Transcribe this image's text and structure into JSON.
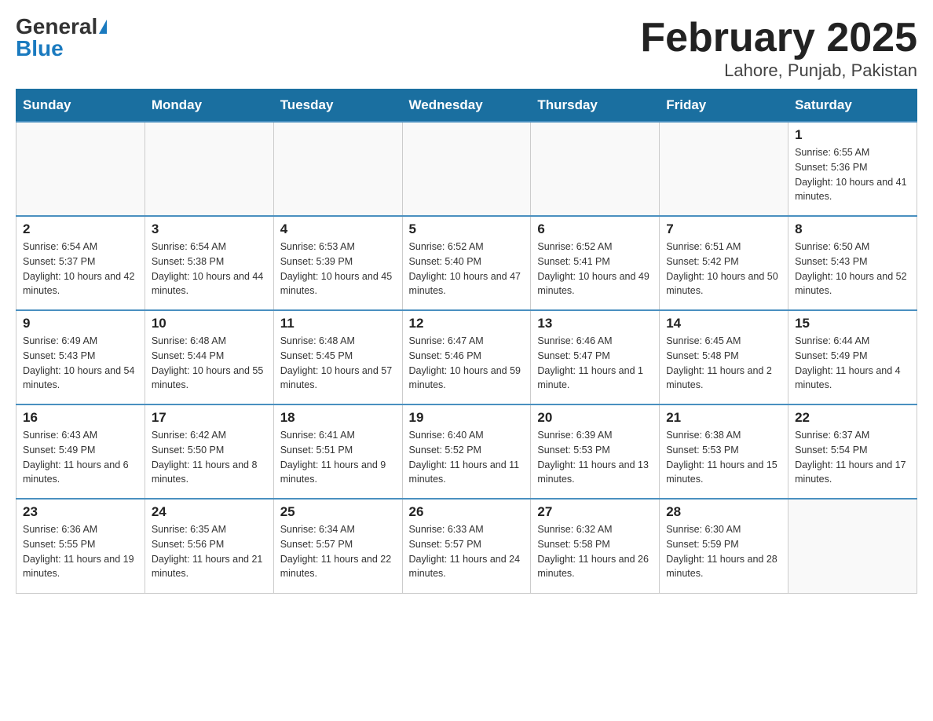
{
  "header": {
    "logo_general": "General",
    "logo_blue": "Blue",
    "month_title": "February 2025",
    "location": "Lahore, Punjab, Pakistan"
  },
  "days_of_week": [
    "Sunday",
    "Monday",
    "Tuesday",
    "Wednesday",
    "Thursday",
    "Friday",
    "Saturday"
  ],
  "weeks": [
    [
      {
        "day": "",
        "sunrise": "",
        "sunset": "",
        "daylight": ""
      },
      {
        "day": "",
        "sunrise": "",
        "sunset": "",
        "daylight": ""
      },
      {
        "day": "",
        "sunrise": "",
        "sunset": "",
        "daylight": ""
      },
      {
        "day": "",
        "sunrise": "",
        "sunset": "",
        "daylight": ""
      },
      {
        "day": "",
        "sunrise": "",
        "sunset": "",
        "daylight": ""
      },
      {
        "day": "",
        "sunrise": "",
        "sunset": "",
        "daylight": ""
      },
      {
        "day": "1",
        "sunrise": "Sunrise: 6:55 AM",
        "sunset": "Sunset: 5:36 PM",
        "daylight": "Daylight: 10 hours and 41 minutes."
      }
    ],
    [
      {
        "day": "2",
        "sunrise": "Sunrise: 6:54 AM",
        "sunset": "Sunset: 5:37 PM",
        "daylight": "Daylight: 10 hours and 42 minutes."
      },
      {
        "day": "3",
        "sunrise": "Sunrise: 6:54 AM",
        "sunset": "Sunset: 5:38 PM",
        "daylight": "Daylight: 10 hours and 44 minutes."
      },
      {
        "day": "4",
        "sunrise": "Sunrise: 6:53 AM",
        "sunset": "Sunset: 5:39 PM",
        "daylight": "Daylight: 10 hours and 45 minutes."
      },
      {
        "day": "5",
        "sunrise": "Sunrise: 6:52 AM",
        "sunset": "Sunset: 5:40 PM",
        "daylight": "Daylight: 10 hours and 47 minutes."
      },
      {
        "day": "6",
        "sunrise": "Sunrise: 6:52 AM",
        "sunset": "Sunset: 5:41 PM",
        "daylight": "Daylight: 10 hours and 49 minutes."
      },
      {
        "day": "7",
        "sunrise": "Sunrise: 6:51 AM",
        "sunset": "Sunset: 5:42 PM",
        "daylight": "Daylight: 10 hours and 50 minutes."
      },
      {
        "day": "8",
        "sunrise": "Sunrise: 6:50 AM",
        "sunset": "Sunset: 5:43 PM",
        "daylight": "Daylight: 10 hours and 52 minutes."
      }
    ],
    [
      {
        "day": "9",
        "sunrise": "Sunrise: 6:49 AM",
        "sunset": "Sunset: 5:43 PM",
        "daylight": "Daylight: 10 hours and 54 minutes."
      },
      {
        "day": "10",
        "sunrise": "Sunrise: 6:48 AM",
        "sunset": "Sunset: 5:44 PM",
        "daylight": "Daylight: 10 hours and 55 minutes."
      },
      {
        "day": "11",
        "sunrise": "Sunrise: 6:48 AM",
        "sunset": "Sunset: 5:45 PM",
        "daylight": "Daylight: 10 hours and 57 minutes."
      },
      {
        "day": "12",
        "sunrise": "Sunrise: 6:47 AM",
        "sunset": "Sunset: 5:46 PM",
        "daylight": "Daylight: 10 hours and 59 minutes."
      },
      {
        "day": "13",
        "sunrise": "Sunrise: 6:46 AM",
        "sunset": "Sunset: 5:47 PM",
        "daylight": "Daylight: 11 hours and 1 minute."
      },
      {
        "day": "14",
        "sunrise": "Sunrise: 6:45 AM",
        "sunset": "Sunset: 5:48 PM",
        "daylight": "Daylight: 11 hours and 2 minutes."
      },
      {
        "day": "15",
        "sunrise": "Sunrise: 6:44 AM",
        "sunset": "Sunset: 5:49 PM",
        "daylight": "Daylight: 11 hours and 4 minutes."
      }
    ],
    [
      {
        "day": "16",
        "sunrise": "Sunrise: 6:43 AM",
        "sunset": "Sunset: 5:49 PM",
        "daylight": "Daylight: 11 hours and 6 minutes."
      },
      {
        "day": "17",
        "sunrise": "Sunrise: 6:42 AM",
        "sunset": "Sunset: 5:50 PM",
        "daylight": "Daylight: 11 hours and 8 minutes."
      },
      {
        "day": "18",
        "sunrise": "Sunrise: 6:41 AM",
        "sunset": "Sunset: 5:51 PM",
        "daylight": "Daylight: 11 hours and 9 minutes."
      },
      {
        "day": "19",
        "sunrise": "Sunrise: 6:40 AM",
        "sunset": "Sunset: 5:52 PM",
        "daylight": "Daylight: 11 hours and 11 minutes."
      },
      {
        "day": "20",
        "sunrise": "Sunrise: 6:39 AM",
        "sunset": "Sunset: 5:53 PM",
        "daylight": "Daylight: 11 hours and 13 minutes."
      },
      {
        "day": "21",
        "sunrise": "Sunrise: 6:38 AM",
        "sunset": "Sunset: 5:53 PM",
        "daylight": "Daylight: 11 hours and 15 minutes."
      },
      {
        "day": "22",
        "sunrise": "Sunrise: 6:37 AM",
        "sunset": "Sunset: 5:54 PM",
        "daylight": "Daylight: 11 hours and 17 minutes."
      }
    ],
    [
      {
        "day": "23",
        "sunrise": "Sunrise: 6:36 AM",
        "sunset": "Sunset: 5:55 PM",
        "daylight": "Daylight: 11 hours and 19 minutes."
      },
      {
        "day": "24",
        "sunrise": "Sunrise: 6:35 AM",
        "sunset": "Sunset: 5:56 PM",
        "daylight": "Daylight: 11 hours and 21 minutes."
      },
      {
        "day": "25",
        "sunrise": "Sunrise: 6:34 AM",
        "sunset": "Sunset: 5:57 PM",
        "daylight": "Daylight: 11 hours and 22 minutes."
      },
      {
        "day": "26",
        "sunrise": "Sunrise: 6:33 AM",
        "sunset": "Sunset: 5:57 PM",
        "daylight": "Daylight: 11 hours and 24 minutes."
      },
      {
        "day": "27",
        "sunrise": "Sunrise: 6:32 AM",
        "sunset": "Sunset: 5:58 PM",
        "daylight": "Daylight: 11 hours and 26 minutes."
      },
      {
        "day": "28",
        "sunrise": "Sunrise: 6:30 AM",
        "sunset": "Sunset: 5:59 PM",
        "daylight": "Daylight: 11 hours and 28 minutes."
      },
      {
        "day": "",
        "sunrise": "",
        "sunset": "",
        "daylight": ""
      }
    ]
  ]
}
